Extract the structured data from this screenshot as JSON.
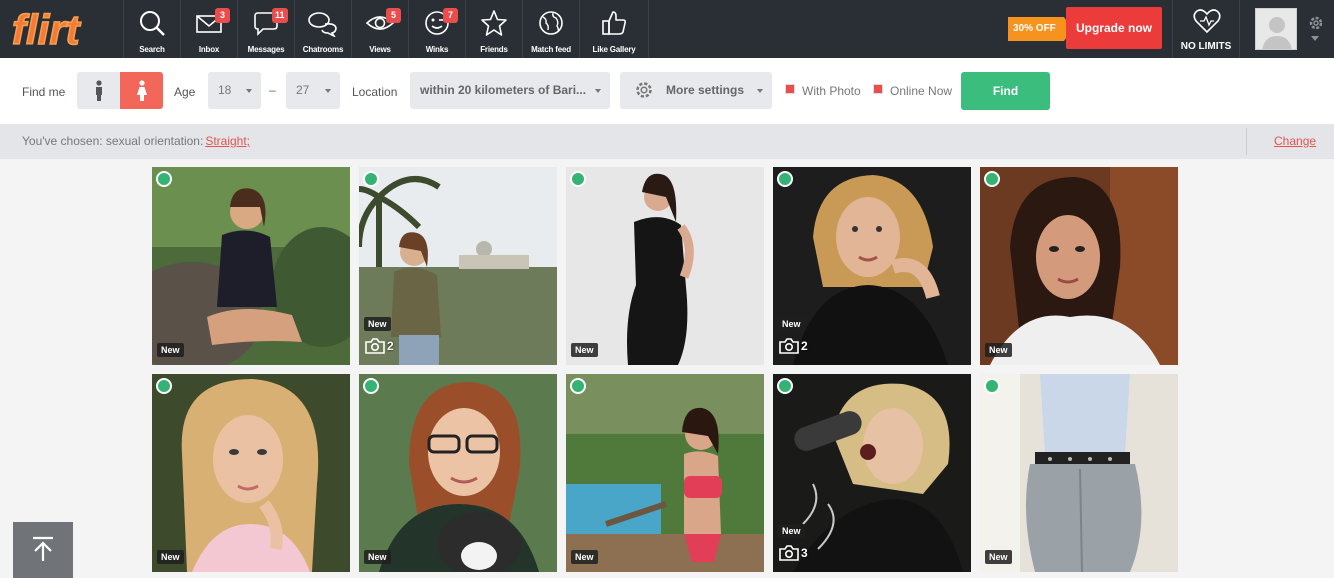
{
  "brand": {
    "logo_text": "flirt"
  },
  "nav": [
    {
      "label": "Search",
      "icon": "search-icon",
      "badge": ""
    },
    {
      "label": "Inbox",
      "icon": "envelope-icon",
      "badge": "3"
    },
    {
      "label": "Messages",
      "icon": "chat-bubble-icon",
      "badge": "11"
    },
    {
      "label": "Chatrooms",
      "icon": "chatrooms-icon",
      "badge": ""
    },
    {
      "label": "Views",
      "icon": "eye-icon",
      "badge": "5"
    },
    {
      "label": "Winks",
      "icon": "wink-face-icon",
      "badge": "7"
    },
    {
      "label": "Friends",
      "icon": "star-icon",
      "badge": ""
    },
    {
      "label": "Match feed",
      "icon": "globe-icon",
      "badge": ""
    },
    {
      "label": "Like Gallery",
      "icon": "thumbs-up-icon",
      "badge": ""
    }
  ],
  "promo": {
    "discount": "30% OFF",
    "upgrade_label": "Upgrade now",
    "no_limits_label": "NO LIMITS"
  },
  "filters": {
    "find_me_label": "Find me",
    "age_label": "Age",
    "age_from": "18",
    "age_separator": "–",
    "age_to": "27",
    "location_label": "Location",
    "location_value": "within 20 kilometers of Bari...",
    "more_settings_label": "More settings",
    "with_photo_label": "With Photo",
    "online_now_label": "Online Now",
    "find_label": "Find"
  },
  "chosen": {
    "prefix": "You've chosen: sexual orientation:",
    "value": "Straight;",
    "change_label": "Change"
  },
  "profiles": [
    {
      "new_label": "New",
      "photo_count": ""
    },
    {
      "new_label": "New",
      "photo_count": "2"
    },
    {
      "new_label": "New",
      "photo_count": ""
    },
    {
      "new_label": "New",
      "photo_count": "2"
    },
    {
      "new_label": "New",
      "photo_count": ""
    },
    {
      "new_label": "New",
      "photo_count": ""
    },
    {
      "new_label": "New",
      "photo_count": ""
    },
    {
      "new_label": "New",
      "photo_count": ""
    },
    {
      "new_label": "New",
      "photo_count": "3"
    },
    {
      "new_label": "New",
      "photo_count": ""
    }
  ],
  "colors": {
    "nav_bg": "#2a2f36",
    "accent_red": "#ec3b3b",
    "accent_green": "#3bbd7e",
    "badge": "#ea4d4d",
    "promo": "#f6921e"
  }
}
